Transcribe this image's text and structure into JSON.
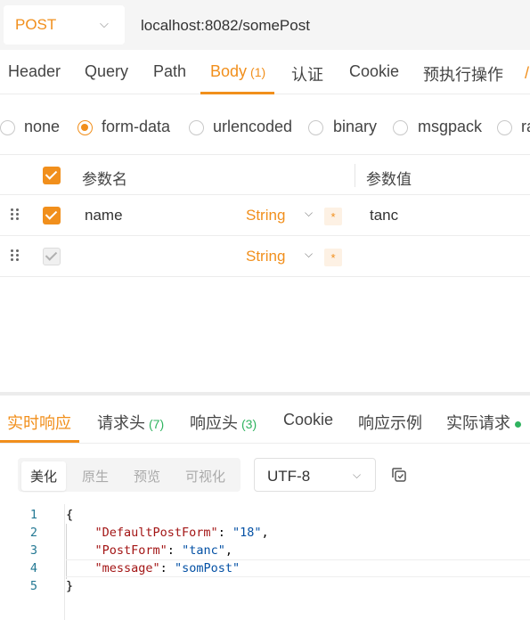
{
  "request": {
    "method": "POST",
    "url": "localhost:8082/somePost"
  },
  "request_tabs": [
    {
      "label": "Header"
    },
    {
      "label": "Query"
    },
    {
      "label": "Path"
    },
    {
      "label": "Body",
      "count": "(1)"
    },
    {
      "label": "认证"
    },
    {
      "label": "Cookie"
    },
    {
      "label": "预执行操作"
    }
  ],
  "body_types": [
    "none",
    "form-data",
    "urlencoded",
    "binary",
    "msgpack",
    "ra"
  ],
  "selected_body_type": "form-data",
  "params_table": {
    "header_name": "参数名",
    "header_value": "参数值",
    "rows": [
      {
        "name": "name",
        "type": "String",
        "required": "*",
        "value": "tanc"
      },
      {
        "name": "",
        "type": "String",
        "required": "*",
        "value": ""
      }
    ]
  },
  "response_tabs": [
    {
      "label": "实时响应"
    },
    {
      "label": "请求头",
      "count": "(7)"
    },
    {
      "label": "响应头",
      "count": "(3)"
    },
    {
      "label": "Cookie"
    },
    {
      "label": "响应示例"
    },
    {
      "label": "实际请求"
    }
  ],
  "view_modes": [
    "美化",
    "原生",
    "预览",
    "可视化"
  ],
  "encoding": "UTF-8",
  "response_code": {
    "line_numbers": [
      "1",
      "2",
      "3",
      "4",
      "5"
    ],
    "open_brace": "{",
    "close_brace": "}",
    "entries": [
      {
        "key": "\"DefaultPostForm\"",
        "value": "\"18\"",
        "sep": ","
      },
      {
        "key": "\"PostForm\"",
        "value": "\"tanc\"",
        "sep": ","
      },
      {
        "key": "\"message\"",
        "value": "\"somPost\"",
        "sep": ""
      }
    ]
  },
  "icons": {
    "method_dropdown": "chevron-down-icon",
    "drag_handle": "drag-handle-icon",
    "copy": "copy-icon"
  },
  "colors": {
    "accent": "#f18f1c",
    "success": "#2fb35f",
    "json_key": "#a31515",
    "json_string": "#0451a5",
    "line_number": "#237893"
  }
}
